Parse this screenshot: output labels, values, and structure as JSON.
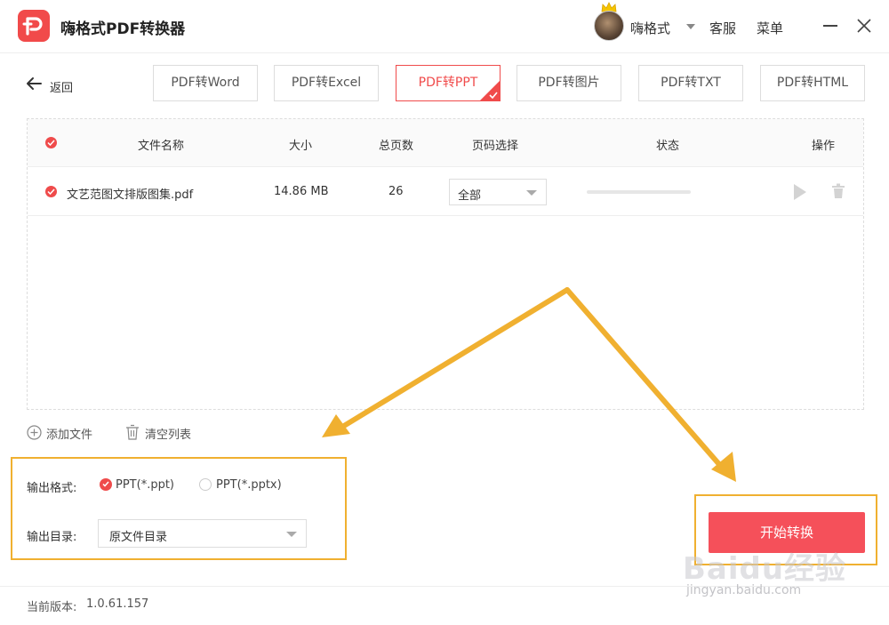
{
  "titlebar": {
    "app_title": "嗨格式PDF转换器",
    "username": "嗨格式",
    "service_label": "客服",
    "menu_label": "菜单"
  },
  "nav": {
    "back_label": "返回",
    "tabs": [
      {
        "label": "PDF转Word",
        "active": false
      },
      {
        "label": "PDF转Excel",
        "active": false
      },
      {
        "label": "PDF转PPT",
        "active": true
      },
      {
        "label": "PDF转图片",
        "active": false
      },
      {
        "label": "PDF转TXT",
        "active": false
      },
      {
        "label": "PDF转HTML",
        "active": false
      }
    ]
  },
  "table": {
    "headers": {
      "name": "文件名称",
      "size": "大小",
      "pages": "总页数",
      "page_select": "页码选择",
      "status": "状态",
      "actions": "操作"
    },
    "rows": [
      {
        "name": "文艺范图文排版图集.pdf",
        "size": "14.86 MB",
        "pages": "26",
        "page_select": "全部",
        "progress": 0
      }
    ]
  },
  "actions": {
    "add_file": "添加文件",
    "clear_list": "清空列表"
  },
  "output": {
    "format_label": "输出格式:",
    "format_options": [
      {
        "label": "PPT(*.ppt)",
        "selected": true
      },
      {
        "label": "PPT(*.pptx)",
        "selected": false
      }
    ],
    "dir_label": "输出目录:",
    "dir_value": "原文件目录"
  },
  "start_button": "开始转换",
  "footer": {
    "version_label": "当前版本:",
    "version": "1.0.61.157"
  },
  "watermark": {
    "main": "Baidu经验",
    "sub": "jingyan.baidu.com"
  },
  "colors": {
    "accent": "#f04b4b",
    "annotation": "#f0b030"
  }
}
